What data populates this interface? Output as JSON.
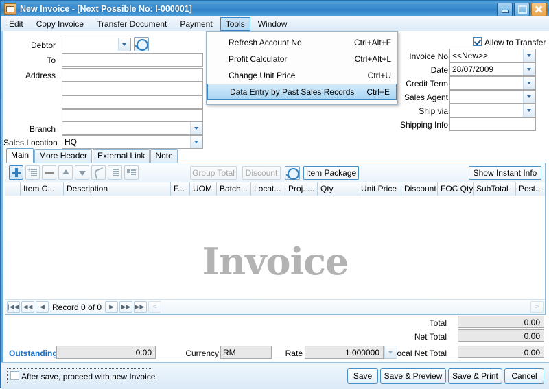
{
  "window": {
    "title": "New Invoice - [Next Possible No: I-000001]",
    "icon": "invoice-document-icon",
    "buttons": {
      "minimize": "minimize",
      "maximize": "maximize",
      "close": "close"
    }
  },
  "menubar": {
    "items": [
      {
        "label": "Edit",
        "active": false
      },
      {
        "label": "Copy Invoice",
        "active": false
      },
      {
        "label": "Transfer Document",
        "active": false
      },
      {
        "label": "Payment",
        "active": false
      },
      {
        "label": "Tools",
        "active": true
      },
      {
        "label": "Window",
        "active": false
      }
    ]
  },
  "tools_menu": {
    "items": [
      {
        "label": "Refresh Account No",
        "shortcut": "Ctrl+Alt+F",
        "selected": false
      },
      {
        "label": "Profit Calculator",
        "shortcut": "Ctrl+Alt+L",
        "selected": false
      },
      {
        "label": "Change Unit Price",
        "shortcut": "Ctrl+U",
        "selected": false
      },
      {
        "label": "Data Entry by Past Sales Records",
        "shortcut": "Ctrl+E",
        "selected": true
      }
    ]
  },
  "header_left": {
    "debtor_label": "Debtor",
    "debtor_value": "",
    "to_label": "To",
    "to_value": "",
    "address_label": "Address",
    "address_lines": [
      "",
      "",
      "",
      ""
    ],
    "branch_label": "Branch",
    "branch_value": "",
    "sales_location_label": "Sales Location",
    "sales_location_value": "HQ",
    "search_icon": "magnifier-icon"
  },
  "header_right": {
    "allow_transfer_label": "Allow to Transfer",
    "allow_transfer_checked": true,
    "invoice_no_label": "Invoice No",
    "invoice_no_value": "<<New>>",
    "date_label": "Date",
    "date_value": "28/07/2009",
    "credit_term_label": "Credit Term",
    "credit_term_value": "",
    "sales_agent_label": "Sales Agent",
    "sales_agent_value": "",
    "ship_via_label": "Ship via",
    "ship_via_value": "",
    "shipping_info_label": "Shipping Info",
    "shipping_info_value": ""
  },
  "tabs": [
    {
      "label": "Main",
      "active": true
    },
    {
      "label": "More Header",
      "active": false
    },
    {
      "label": "External Link",
      "active": false
    },
    {
      "label": "Note",
      "active": false
    }
  ],
  "grid_toolbar": {
    "icons": [
      {
        "name": "add-row-icon",
        "enabled": true
      },
      {
        "name": "insert-row-icon",
        "enabled": false
      },
      {
        "name": "delete-row-icon",
        "enabled": true
      },
      {
        "name": "move-up-icon",
        "enabled": true
      },
      {
        "name": "move-down-icon",
        "enabled": true
      },
      {
        "name": "undo-icon",
        "enabled": true
      },
      {
        "name": "indent-list-icon",
        "enabled": true
      },
      {
        "name": "detail-view-icon",
        "enabled": true
      }
    ],
    "group_total_label": "Group Total",
    "group_total_enabled": false,
    "discount_label": "Discount",
    "discount_enabled": false,
    "search_icon": "magnifier-icon",
    "item_package_label": "Item Package",
    "show_instant_info_label": "Show Instant Info"
  },
  "grid": {
    "columns": [
      {
        "label": "",
        "width": 22
      },
      {
        "label": "Item C...",
        "width": 63
      },
      {
        "label": "Description",
        "width": 156
      },
      {
        "label": "F...",
        "width": 28
      },
      {
        "label": "UOM",
        "width": 39
      },
      {
        "label": "Batch...",
        "width": 50
      },
      {
        "label": "Locat...",
        "width": 50
      },
      {
        "label": "Proj. ...",
        "width": 47
      },
      {
        "label": "Qty",
        "width": 59
      },
      {
        "label": "Unit Price",
        "width": 63
      },
      {
        "label": "Discount",
        "width": 53
      },
      {
        "label": "FOC Qty",
        "width": 52
      },
      {
        "label": "SubTotal",
        "width": 62
      },
      {
        "label": "Post...",
        "width": 42
      }
    ],
    "rows": [],
    "watermark": "Invoice",
    "navigator": {
      "record_text": "Record 0 of 0",
      "buttons": [
        "first",
        "prev-page",
        "prev",
        "next",
        "next-page",
        "last"
      ],
      "scroll_left": "<",
      "scroll_right": ">"
    }
  },
  "totals": [
    {
      "label": "Total",
      "value": "0.00"
    },
    {
      "label": "Net Total",
      "value": "0.00"
    },
    {
      "label": "Local Net Total",
      "value": "0.00"
    }
  ],
  "footer": {
    "outstanding_label": "Outstanding:",
    "outstanding_value": "0.00",
    "currency_label": "Currency",
    "currency_value": "RM",
    "rate_label": "Rate",
    "rate_value": "1.000000"
  },
  "actions": {
    "after_save_label": "After save, proceed with new Invoice",
    "after_save_checked": false,
    "buttons": [
      {
        "label": "Save"
      },
      {
        "label": "Save & Preview"
      },
      {
        "label": "Save & Print"
      },
      {
        "label": "Cancel"
      }
    ]
  },
  "colors": {
    "title_bar": "#3a8ccd",
    "accent": "#2f7fc0",
    "outstanding": "#1a6fc4",
    "watermark": "#b3b3b3"
  }
}
